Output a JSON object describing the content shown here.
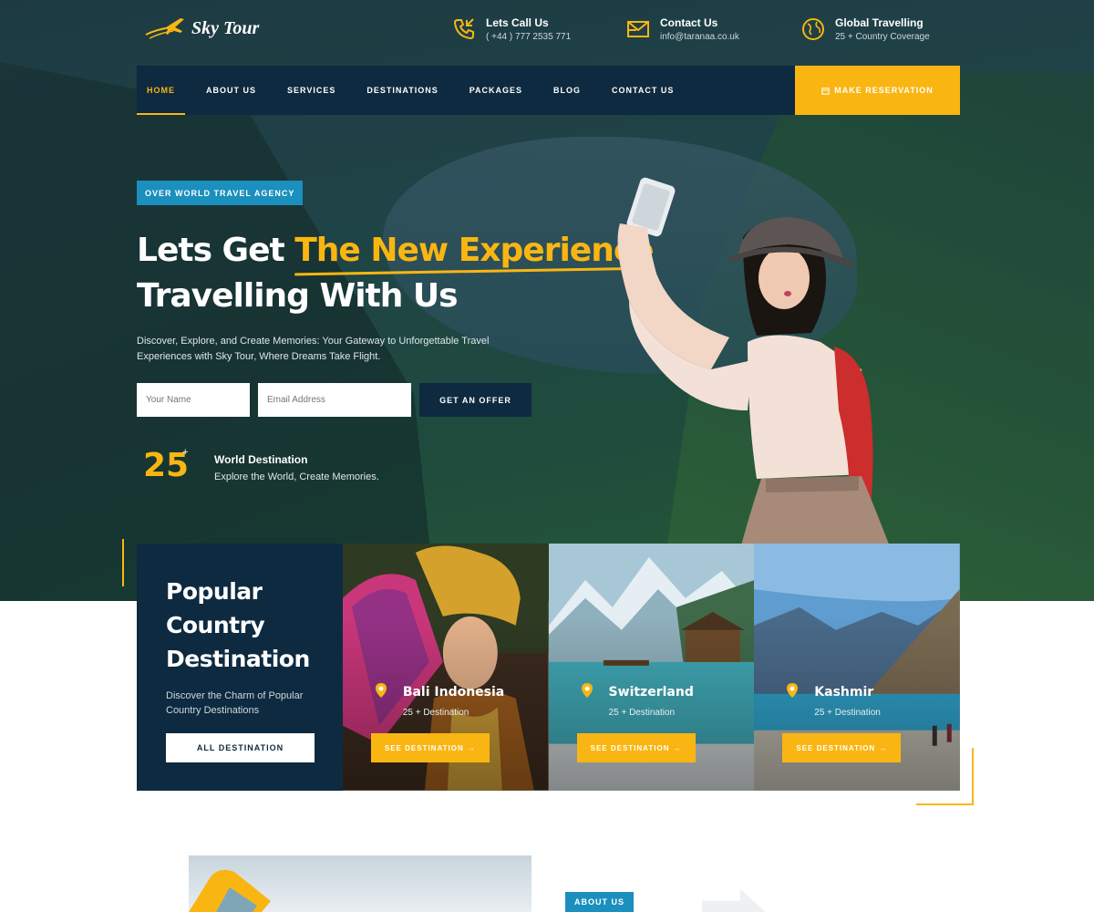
{
  "brand": {
    "name": "Sky Tour"
  },
  "contacts": [
    {
      "icon": "phone-icon",
      "title": "Lets Call Us",
      "sub": "( +44 ) 777 2535 771"
    },
    {
      "icon": "mail-icon",
      "title": "Contact Us",
      "sub": "info@taranaa.co.uk"
    },
    {
      "icon": "globe-icon",
      "title": "Global Travelling",
      "sub": "25 + Country Coverage"
    }
  ],
  "nav": {
    "items": [
      "HOME",
      "ABOUT US",
      "SERVICES",
      "DESTINATIONS",
      "PACKAGES",
      "BLOG",
      "CONTACT US"
    ],
    "active": "HOME",
    "reserve_label": "MAKE RESERVATION"
  },
  "hero": {
    "badge": "OVER WORLD TRAVEL AGENCY",
    "headline_pre": "Lets Get ",
    "headline_highlight": "The New Experience",
    "headline_line2": "Travelling With Us",
    "description": "Discover, Explore, and Create Memories: Your Gateway to Unforgettable Travel Experiences with Sky Tour, Where Dreams Take Flight.",
    "name_placeholder": "Your Name",
    "email_placeholder": "Email Address",
    "offer_button": "GET AN OFFER",
    "stat_number": "25",
    "stat_plus": "+",
    "stat_title": "World Destination",
    "stat_sub": "Explore the World, Create Memories."
  },
  "destinations": {
    "title_lines": [
      "Popular",
      "Country",
      "Destination"
    ],
    "description": "Discover the Charm of Popular Country Destinations",
    "all_button": "ALL DESTINATION",
    "cards": [
      {
        "name": "Bali Indonesia",
        "count": "25 + Destination",
        "button": "SEE DESTINATION"
      },
      {
        "name": "Switzerland",
        "count": "25 + Destination",
        "button": "SEE DESTINATION"
      },
      {
        "name": "Kashmir",
        "count": "25 + Destination",
        "button": "SEE DESTINATION"
      }
    ]
  },
  "about": {
    "badge": "ABOUT US"
  },
  "colors": {
    "accent": "#f9b612",
    "navy": "#0d2a40",
    "badge_blue": "#1b8fbd"
  }
}
